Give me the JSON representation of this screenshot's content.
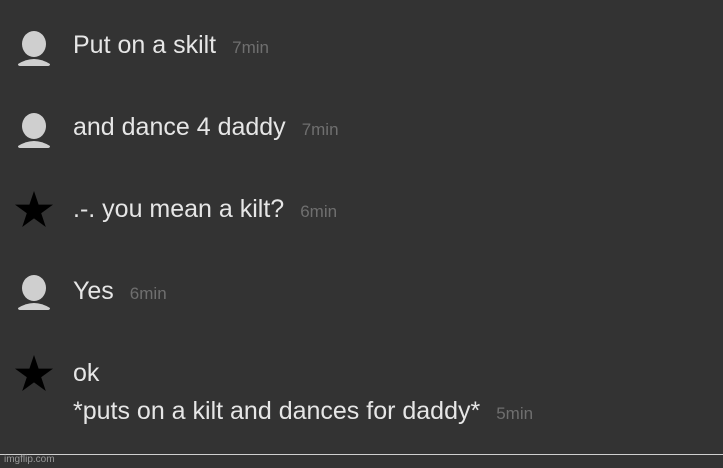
{
  "colors": {
    "background": "#333333",
    "message_text": "#e6e6e6",
    "timestamp": "#6f6f6f",
    "user_icon": "#cfcfcf",
    "star_icon": "#000000"
  },
  "messages": [
    {
      "avatar": "person-icon",
      "text": "Put on a skilt",
      "time": "7min"
    },
    {
      "avatar": "person-icon",
      "text": "and dance 4 daddy",
      "time": "7min"
    },
    {
      "avatar": "star-icon",
      "text": ".-. you mean a kilt?",
      "time": "6min"
    },
    {
      "avatar": "person-icon",
      "text": "Yes",
      "time": "6min"
    },
    {
      "avatar": "star-icon",
      "text": "ok",
      "text2": "*puts on a kilt and dances for daddy*",
      "time": "5min"
    }
  ],
  "watermark": "imgflip.com"
}
